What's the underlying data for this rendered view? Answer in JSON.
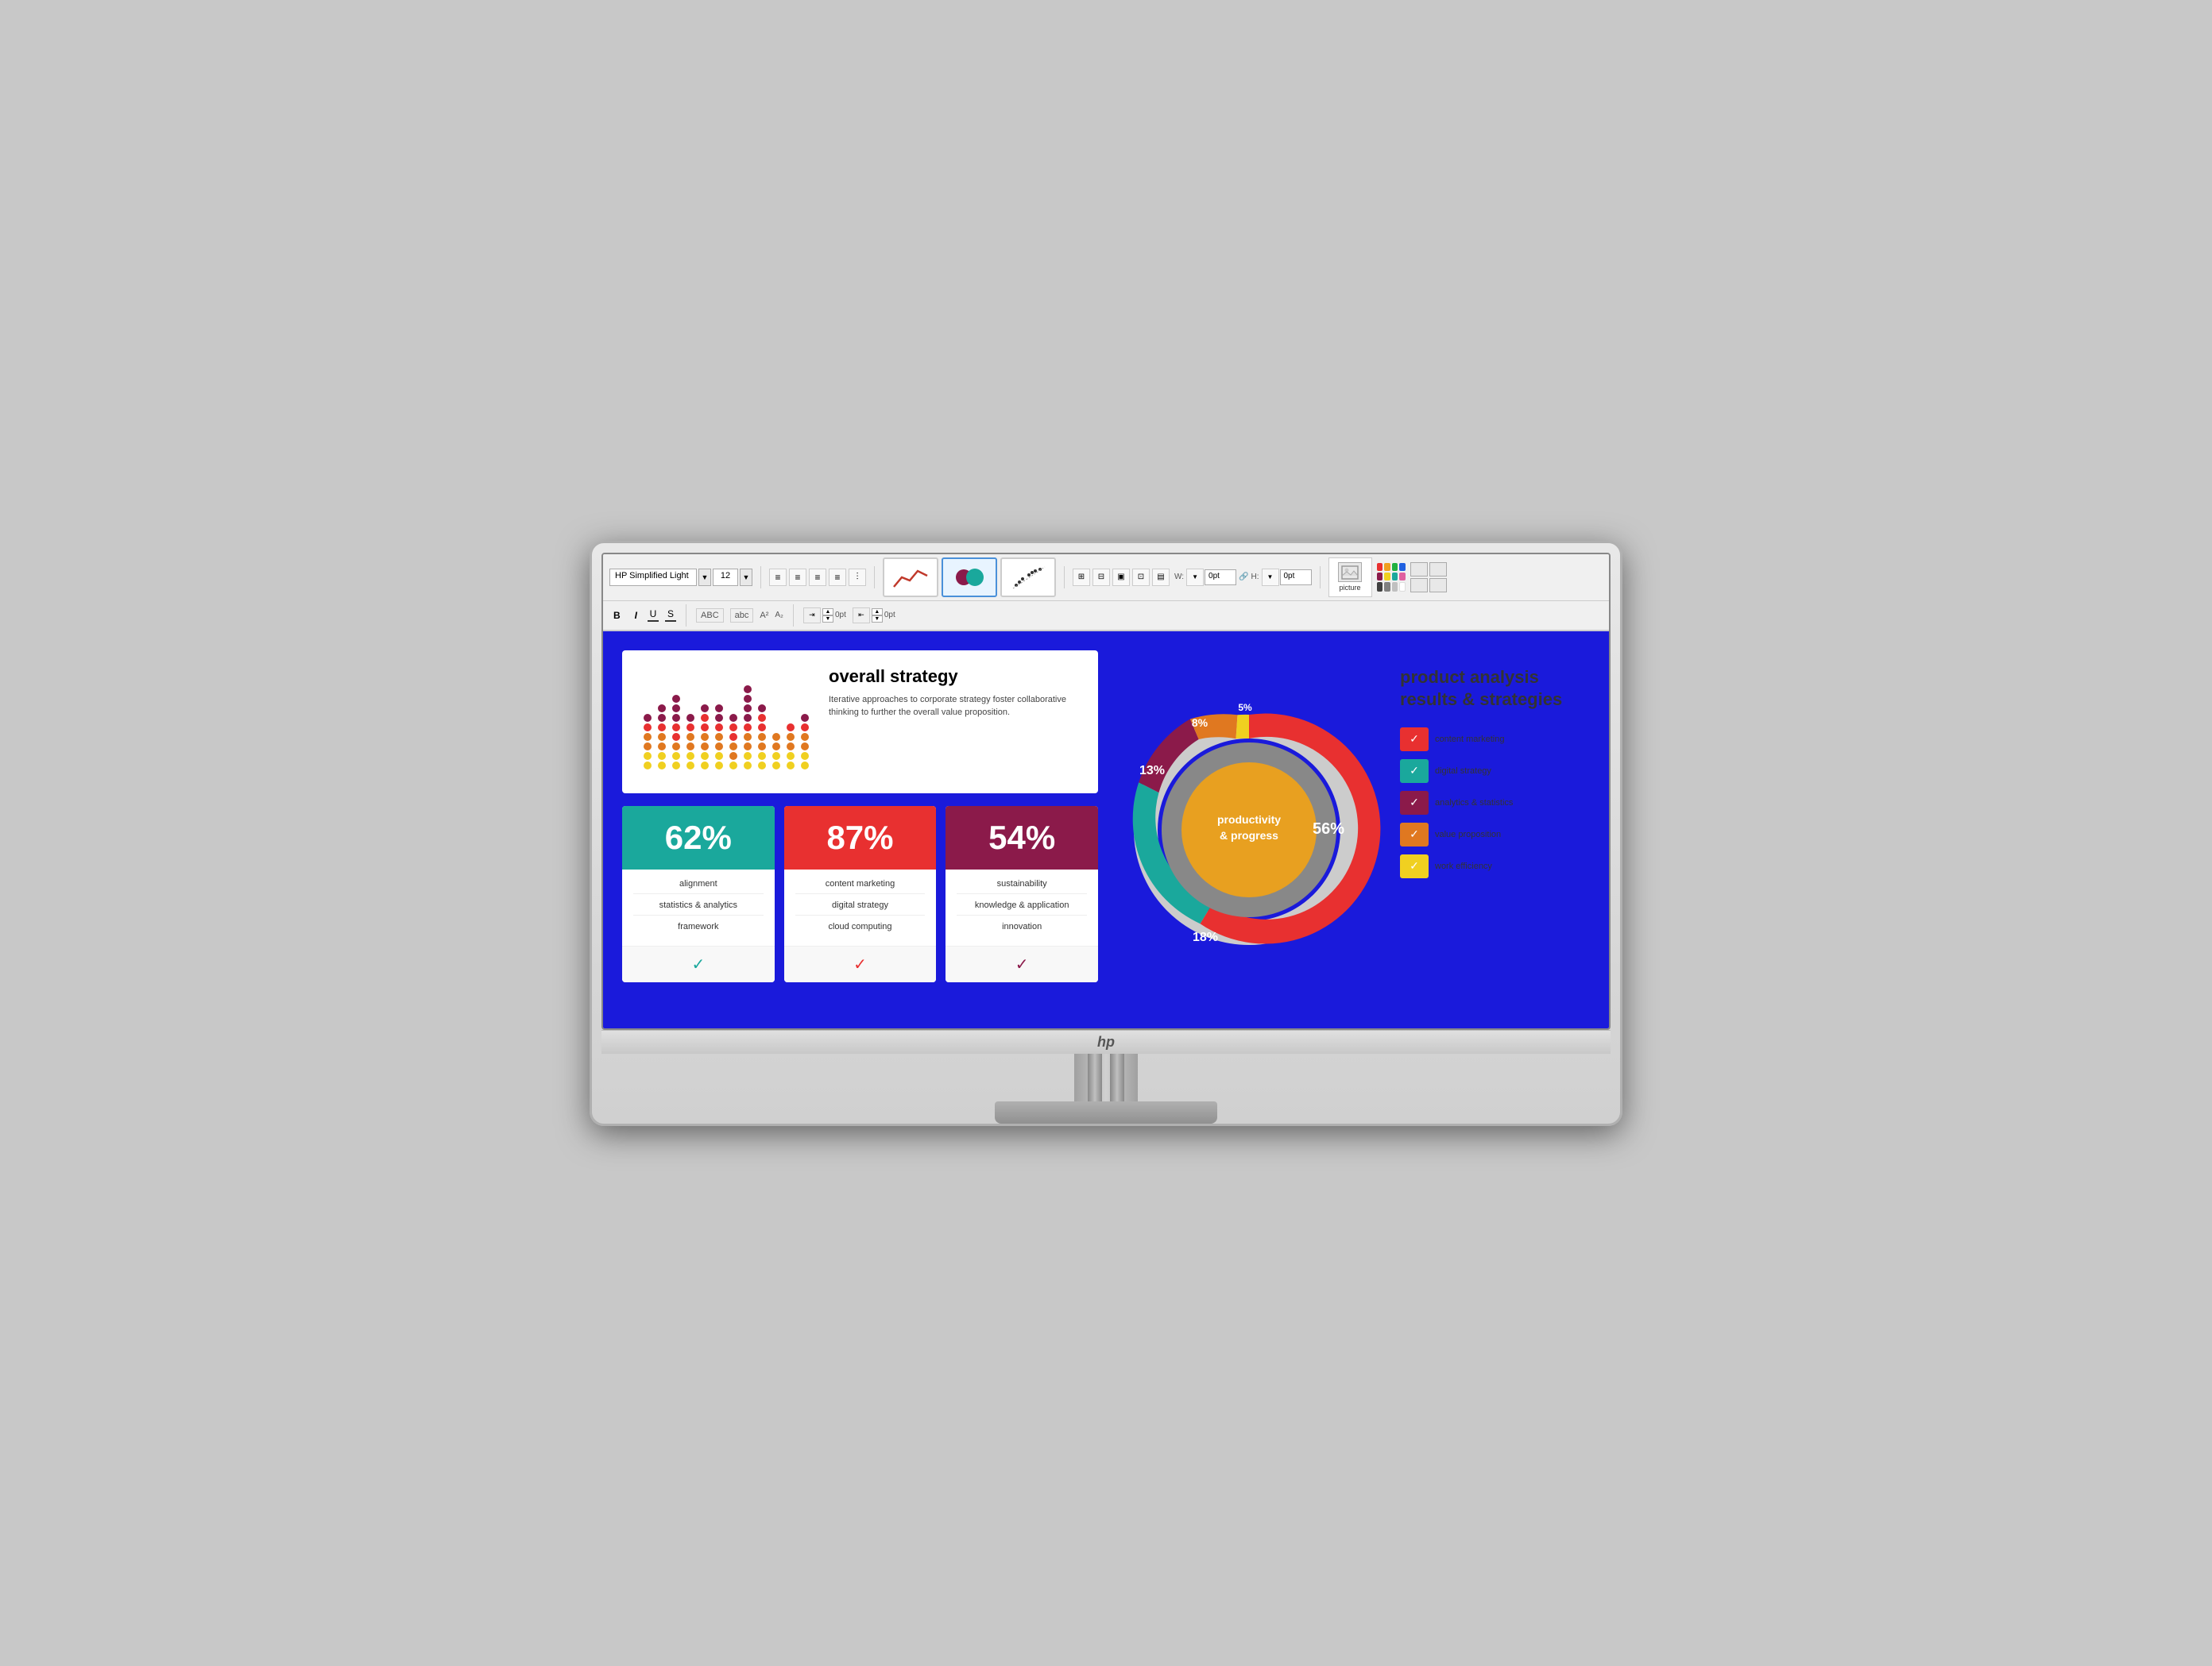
{
  "toolbar": {
    "font_name": "HP Simplified Light",
    "font_size": "12",
    "bold": "B",
    "italic": "I",
    "underline": "U",
    "strikethrough": "S",
    "abc_label": "ABC",
    "abc_lower": "abc",
    "superscript": "A²",
    "subscript": "A₂",
    "indent_val": "0pt",
    "outdent_val": "0pt",
    "width_label": "W:",
    "width_val": "0pt",
    "height_label": "H:",
    "height_val": "0pt",
    "picture_label": "picture"
  },
  "strategy_card": {
    "title": "overall strategy",
    "description": "Iterative approaches to corporate strategy foster collaborative thinking to further the overall value proposition."
  },
  "stats": [
    {
      "percent": "62%",
      "color": "teal",
      "items": [
        "alignment",
        "statistics & analytics",
        "framework"
      ],
      "check_color": "check-teal"
    },
    {
      "percent": "87%",
      "color": "red",
      "items": [
        "content marketing",
        "digital strategy",
        "cloud computing"
      ],
      "check_color": "check-red"
    },
    {
      "percent": "54%",
      "color": "maroon",
      "items": [
        "sustainability",
        "knowledge & application",
        "innovation"
      ],
      "check_color": "check-maroon"
    }
  ],
  "donut": {
    "center_line1": "productivity",
    "center_line2": "& progress",
    "segments": [
      {
        "label": "56%",
        "color": "#e83030",
        "value": 56
      },
      {
        "label": "18%",
        "color": "#1aa89c",
        "value": 18
      },
      {
        "label": "13%",
        "color": "#8b1a4a",
        "value": 13
      },
      {
        "label": "8%",
        "color": "#e07820",
        "value": 8
      },
      {
        "label": "5%",
        "color": "#f0d020",
        "value": 5
      }
    ]
  },
  "product_analysis": {
    "title": "product analysis results & strategies"
  },
  "legend": [
    {
      "label": "content marketing",
      "color": "#e83030"
    },
    {
      "label": "digital strategy",
      "color": "#1aa89c"
    },
    {
      "label": "analytics & statistics",
      "color": "#8b1a4a"
    },
    {
      "label": "value proposition",
      "color": "#e07820"
    },
    {
      "label": "work efficiency",
      "color": "#f0d020"
    }
  ]
}
